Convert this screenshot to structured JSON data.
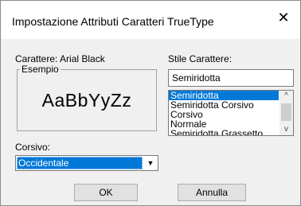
{
  "dialog": {
    "title": "Impostazione Attributi Caratteri TrueType",
    "close_glyph": "✕"
  },
  "font_label": "Carattere: Arial Black",
  "example": {
    "legend": "Esempio",
    "sample_text": "AaBbYyZz"
  },
  "style": {
    "label": "Stile Carattere:",
    "input_value": "Semiridotta",
    "options": [
      "Semiridotta",
      "Semiridotta Corsivo",
      "Corsivo",
      "Normale",
      "Semiridotta Grassetto"
    ],
    "selected_index": 0
  },
  "script": {
    "label": "Corsivo:",
    "selected_value": "Occidentale"
  },
  "buttons": {
    "ok_label": "OK",
    "cancel_label": "Annulla"
  },
  "colors": {
    "selection": "#0078d7",
    "dialog_bg": "#f0f0f0"
  }
}
